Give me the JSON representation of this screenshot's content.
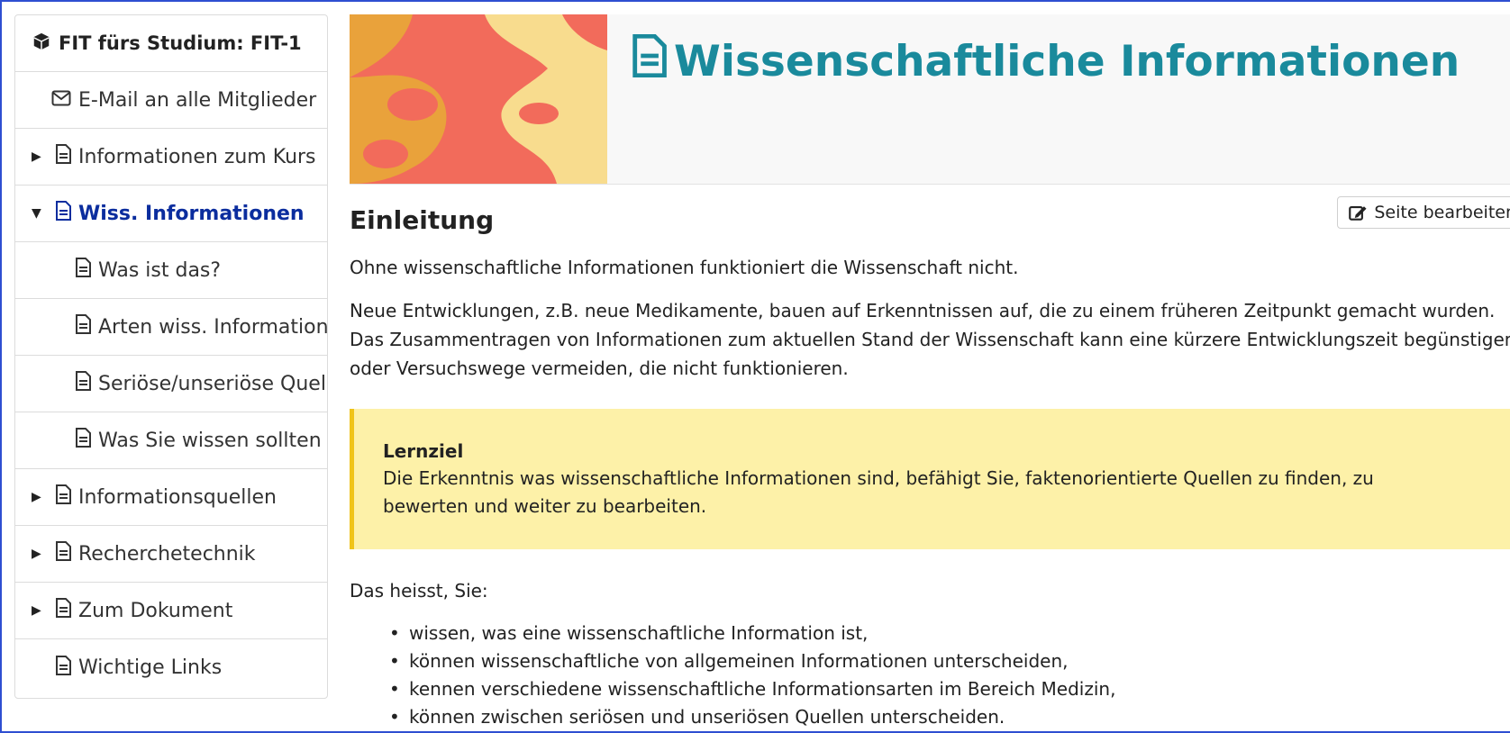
{
  "sidebar": {
    "course_title": "FIT fürs Studium: FIT-1",
    "email_label": "E-Mail an alle Mitglieder",
    "items": [
      {
        "label": "Informationen zum Kurs"
      },
      {
        "label": "Wiss. Informationen"
      },
      {
        "label": "Was ist das?"
      },
      {
        "label": "Arten wiss. Informationen"
      },
      {
        "label": "Seriöse/unseriöse Quellen"
      },
      {
        "label": "Was Sie wissen sollten"
      },
      {
        "label": "Informationsquellen"
      },
      {
        "label": "Recherchetechnik"
      },
      {
        "label": "Zum Dokument"
      },
      {
        "label": "Wichtige Links"
      }
    ]
  },
  "header": {
    "title": "Wissenschaftliche Informationen"
  },
  "main": {
    "edit_label": "Seite bearbeiten",
    "heading": "Einleitung",
    "para1": "Ohne wissenschaftliche Informationen funktioniert die Wissenschaft nicht.",
    "para2": "Neue Entwicklungen, z.B. neue Medikamente, bauen auf Erkenntnissen auf, die zu einem früheren Zeitpunkt gemacht wurden. Das Zusammentragen von Informationen zum aktuellen Stand der Wissenschaft kann eine kürzere Entwicklungszeit begünstigen oder Versuchswege vermeiden, die nicht funktionieren.",
    "callout_label": "Lernziel",
    "callout_text": "Die Erkenntnis was wissenschaftliche Informationen sind, befähigt Sie, faktenorientierte Quellen zu finden, zu bewerten und weiter zu bearbeiten.",
    "intro_list": "Das heisst, Sie:",
    "bullets": [
      "wissen, was eine wissenschaftliche Information ist,",
      "können wissenschaftliche von allgemeinen Informationen unterscheiden,",
      "kennen verschiedene wissenschaftliche Informationsarten im Bereich Medizin,",
      "können zwischen seriösen und unseriösen Quellen unterscheiden."
    ]
  },
  "colors": {
    "accent_title": "#1a8a9c",
    "active_nav": "#0b2d9e",
    "callout_bg": "#fdf1a8",
    "callout_border": "#f0c419",
    "banner_red": "#f26b5b",
    "banner_yellow": "#f8dc8e",
    "banner_orange": "#e9a23b"
  }
}
